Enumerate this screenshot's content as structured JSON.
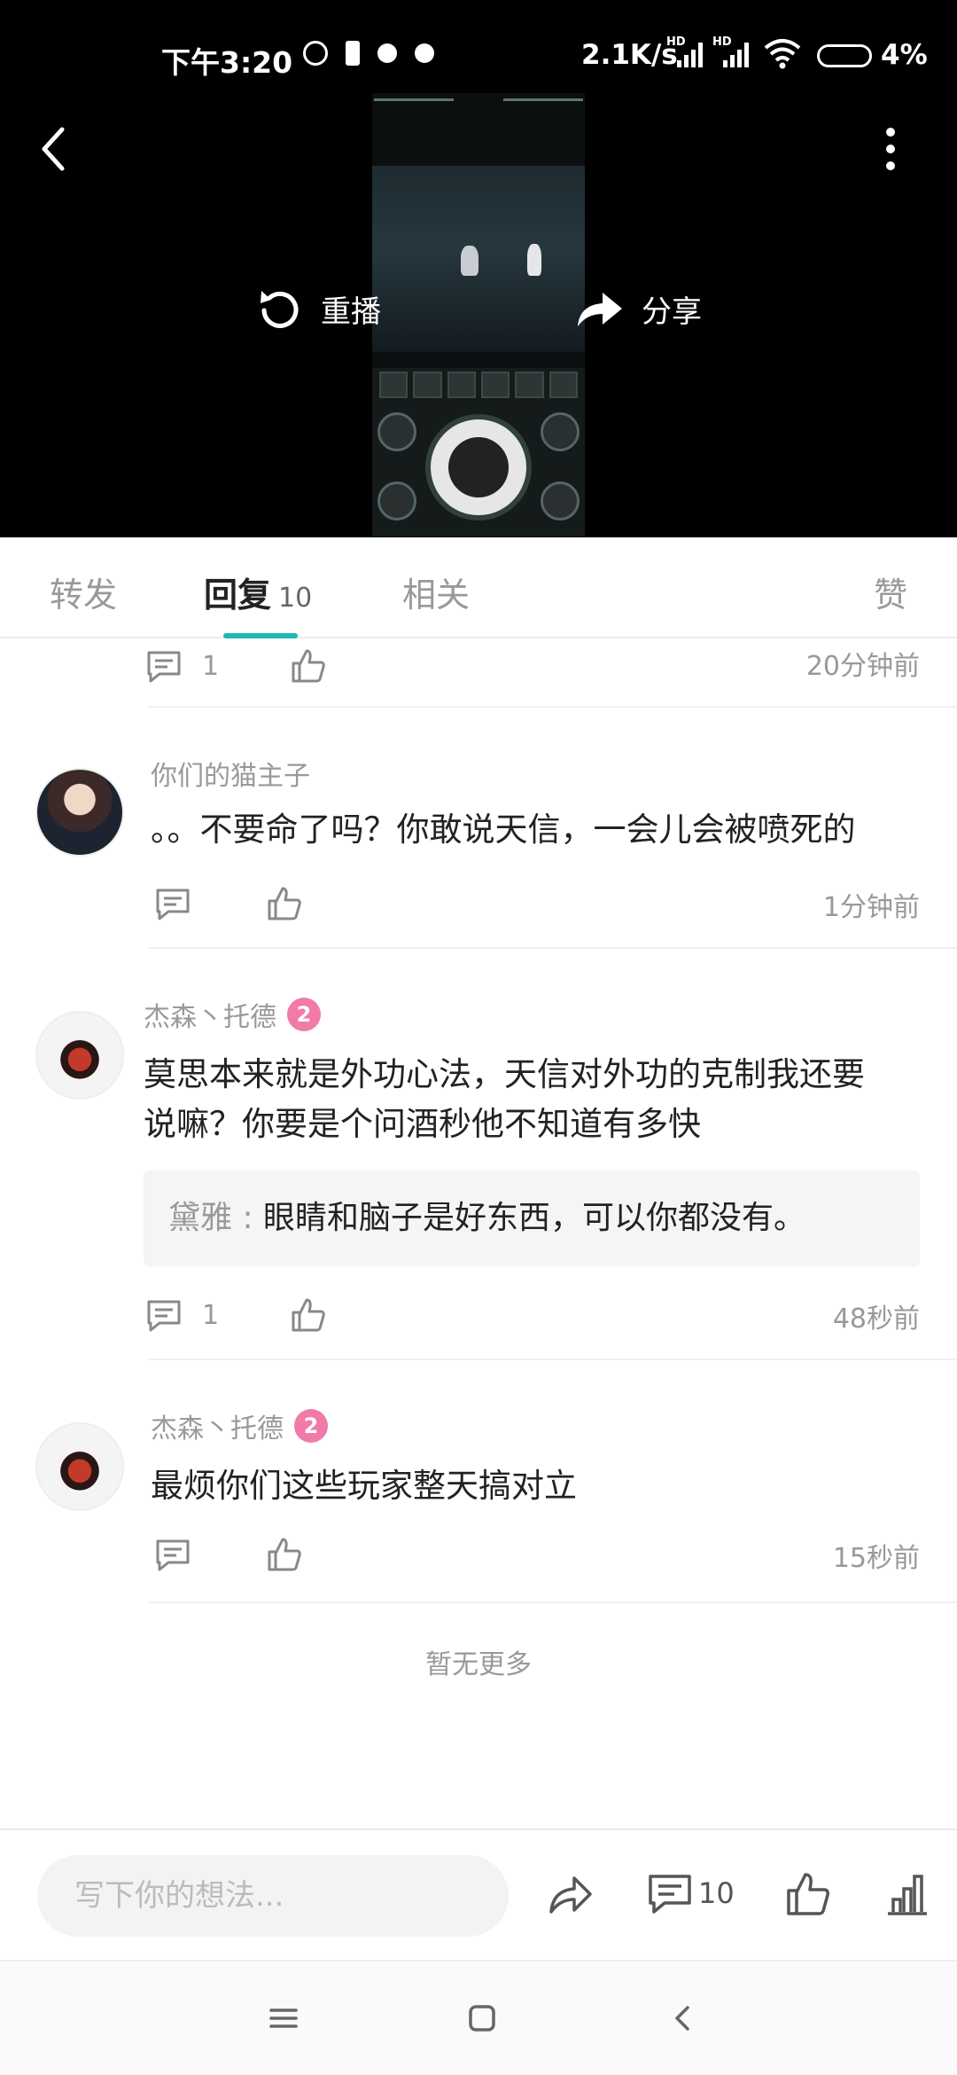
{
  "status_bar": {
    "time": "下午3:20",
    "network_speed": "2.1K/s",
    "hd_label_1": "HD",
    "hd_label_2": "HD",
    "battery_percent": "4%"
  },
  "video": {
    "replay_label": "重播",
    "share_label": "分享"
  },
  "tabs": [
    {
      "label": "转发"
    },
    {
      "label": "回复",
      "count": "10"
    },
    {
      "label": "相关"
    },
    {
      "label": "赞"
    }
  ],
  "comments": {
    "top_partial": {
      "reply_count": "1",
      "time": "20分钟前"
    },
    "items": [
      {
        "username": "你们的猫主子",
        "text_lines": [
          "。。不要命了吗？你敢说天信，一会儿会被喷死的"
        ],
        "time": "1分钟前"
      },
      {
        "username": "杰森丶托德",
        "level": "2",
        "text_lines": [
          "莫思本来就是外功心法，天信对外功的克制我还要",
          "说嘛？你要是个问酒秒他不知道有多快"
        ],
        "quote": {
          "name": "黛雅",
          "separator": " : ",
          "text": "眼睛和脑子是好东西，可以你都没有。"
        },
        "reply_count": "1",
        "time": "48秒前"
      },
      {
        "username": "杰森丶托德",
        "level": "2",
        "text_lines": [
          "最烦你们这些玩家整天搞对立"
        ],
        "time": "15秒前"
      }
    ],
    "no_more": "暂无更多"
  },
  "composer": {
    "placeholder": "写下你的想法...",
    "reply_count": "10"
  },
  "colors": {
    "accent": "#1fb8b3",
    "level_badge": "#f07aa8",
    "muted_text": "#999999"
  }
}
